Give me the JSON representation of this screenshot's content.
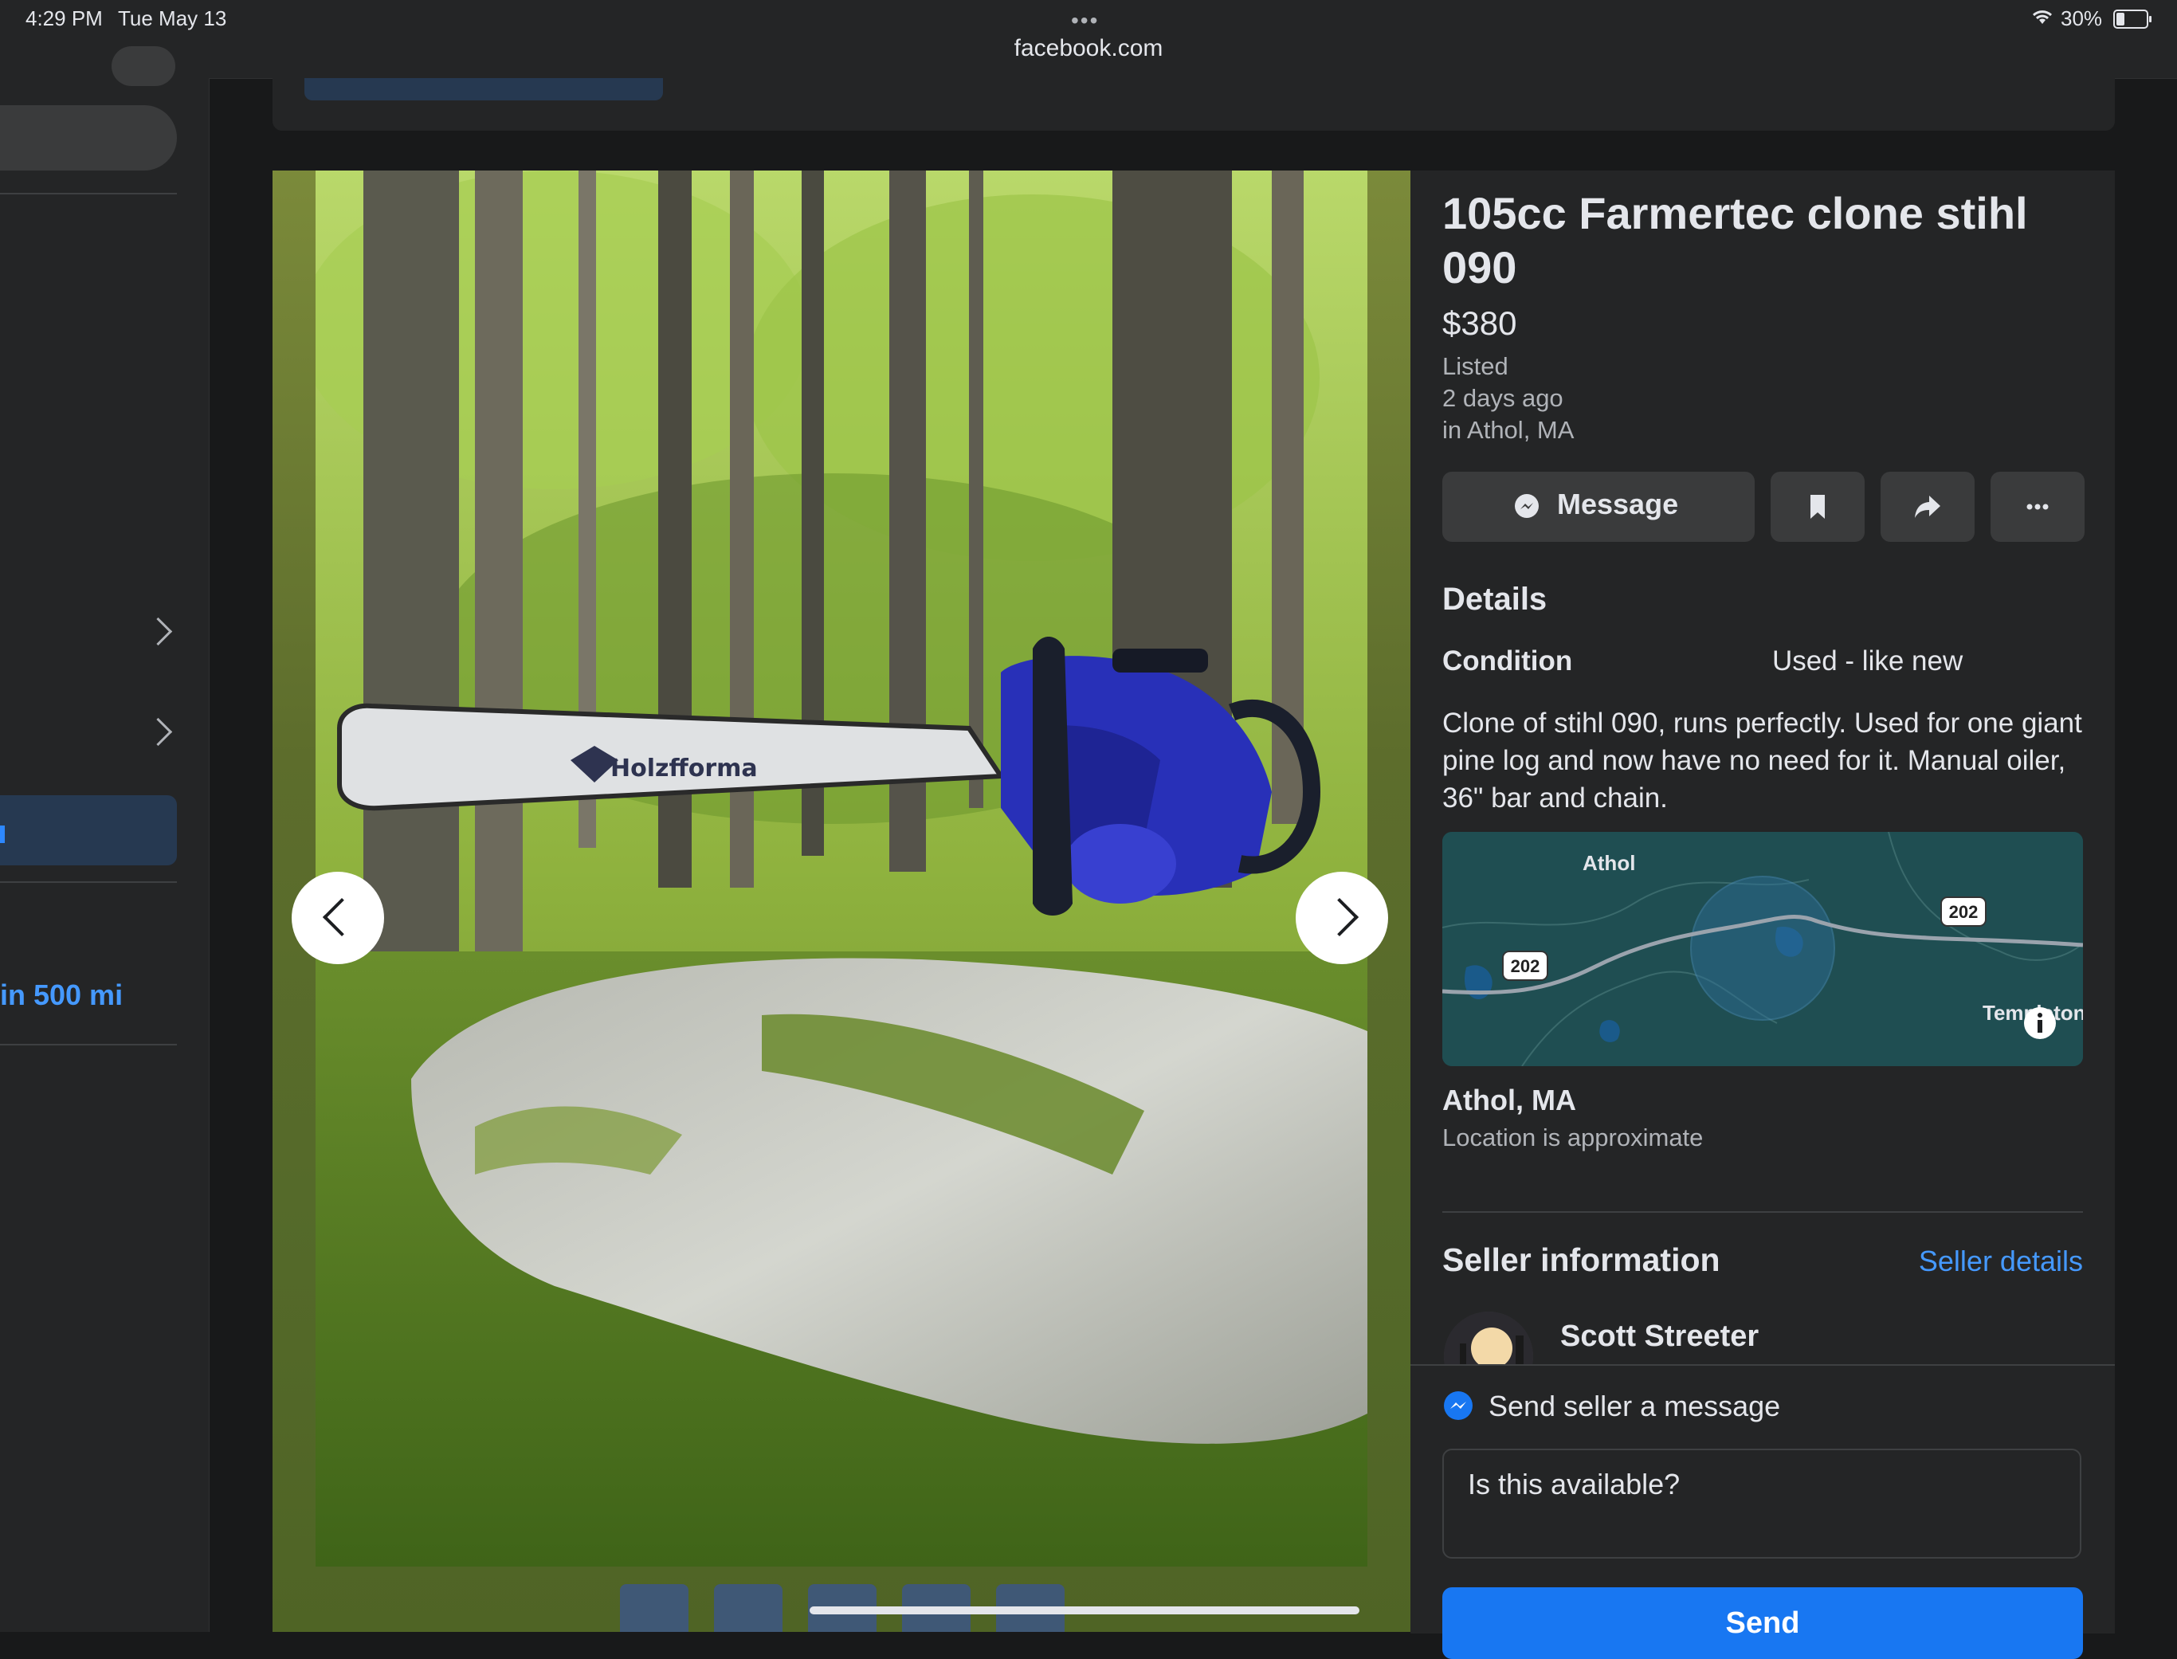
{
  "status_bar": {
    "time": "4:29 PM",
    "date": "Tue May 13",
    "url": "facebook.com",
    "battery": "30%"
  },
  "sidebar": {
    "radius_label": "in 500 mi"
  },
  "listing": {
    "title": "105cc Farmertec clone stihl 090",
    "price": "$380",
    "listed_label": "Listed",
    "listed_time": "2 days ago",
    "listed_location": "in Athol, MA",
    "actions": {
      "message_label": "Message"
    },
    "details": {
      "heading": "Details",
      "condition_label": "Condition",
      "condition_value": "Used - like new",
      "description": "Clone of stihl 090, runs perfectly. Used for one giant pine log and now have no need for it. Manual oiler, 36\" bar and chain."
    },
    "map": {
      "town_label": "Athol",
      "route_label_left": "202",
      "route_label_right": "202",
      "town_label_right": "Templeton",
      "location_title": "Athol, MA",
      "location_note": "Location is approximate"
    },
    "seller": {
      "heading": "Seller information",
      "details_link": "Seller details",
      "name": "Scott Streeter"
    },
    "message_box": {
      "heading": "Send seller a message",
      "input_value": "Is this available?",
      "send_label": "Send"
    },
    "photo": {
      "brand_text": "Holzfforma"
    }
  },
  "colors": {
    "background": "#18191a",
    "surface": "#242526",
    "button": "#3a3b3c",
    "accent": "#1877f2",
    "link": "#4599ff",
    "text_primary": "#e4e6eb",
    "text_secondary": "#b0b3b8"
  },
  "icons": [
    "wifi-icon",
    "battery-icon",
    "messenger-icon",
    "bookmark-icon",
    "share-icon",
    "more-icon",
    "chevron-left-icon",
    "chevron-right-icon",
    "info-icon"
  ]
}
